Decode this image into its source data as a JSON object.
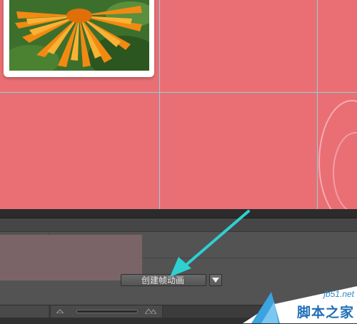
{
  "timeline_panel": {
    "create_frame_animation_label": "创建帧动画",
    "dropdown_icon": "triangle-down-icon"
  },
  "canvas": {
    "background_color": "#e96f75",
    "guide_color": "#8fd0e0",
    "photo_subject": "orange-flower-photo"
  },
  "annotation": {
    "arrow_color": "#2fd0d2"
  },
  "watermark": {
    "url": "jb51.net",
    "name": "脚本之家",
    "brand_color": "#1f6eb8"
  }
}
